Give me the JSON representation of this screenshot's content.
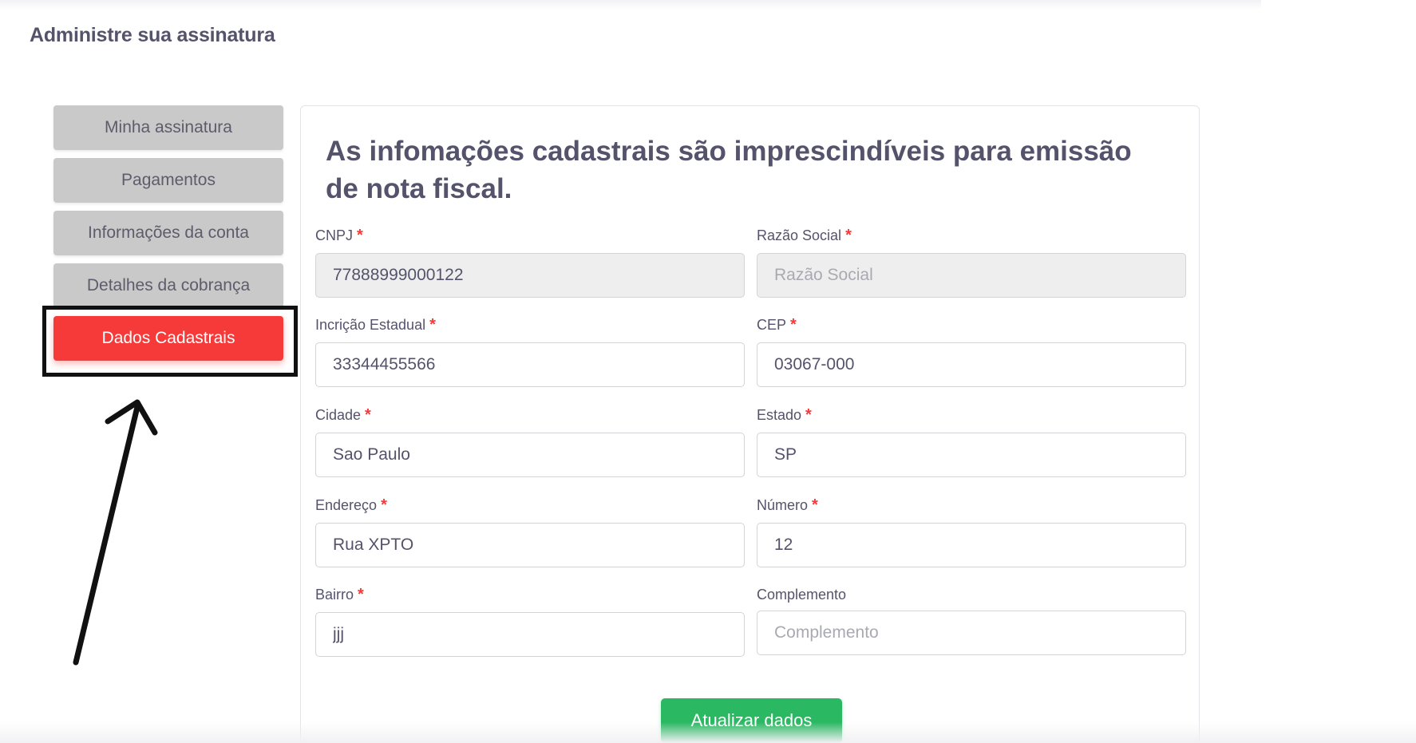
{
  "page": {
    "title": "Administre sua assinatura"
  },
  "sidebar": {
    "items": [
      {
        "label": "Minha assinatura"
      },
      {
        "label": "Pagamentos"
      },
      {
        "label": "Informações da conta"
      },
      {
        "label": "Detalhes da cobrança"
      },
      {
        "label": "Dados Cadastrais",
        "active": true
      }
    ]
  },
  "form": {
    "heading": "As infomações cadastrais são imprescindíveis para emissão de nota fiscal.",
    "required_mark": "*",
    "fields": {
      "cnpj": {
        "label": "CNPJ",
        "value": "77888999000122",
        "placeholder": "CNPJ"
      },
      "razao_social": {
        "label": "Razão Social",
        "value": "",
        "placeholder": "Razão Social"
      },
      "inscricao_estadual": {
        "label": "Incrição Estadual",
        "value": "33344455566",
        "placeholder": ""
      },
      "cep": {
        "label": "CEP",
        "value": "03067-000",
        "placeholder": ""
      },
      "cidade": {
        "label": "Cidade",
        "value": "Sao Paulo",
        "placeholder": ""
      },
      "estado": {
        "label": "Estado",
        "value": "SP",
        "placeholder": ""
      },
      "endereco": {
        "label": "Endereço",
        "value": "Rua XPTO",
        "placeholder": ""
      },
      "numero": {
        "label": "Número",
        "value": "12",
        "placeholder": ""
      },
      "bairro": {
        "label": "Bairro",
        "value": "jjj",
        "placeholder": ""
      },
      "complemento": {
        "label": "Complemento",
        "value": "",
        "placeholder": "Complemento"
      }
    },
    "submit_label": "Atualizar dados"
  },
  "colors": {
    "active": "#f63a3a",
    "inactive": "#c9c9c9",
    "submit": "#2bb862",
    "text": "#55536b"
  }
}
